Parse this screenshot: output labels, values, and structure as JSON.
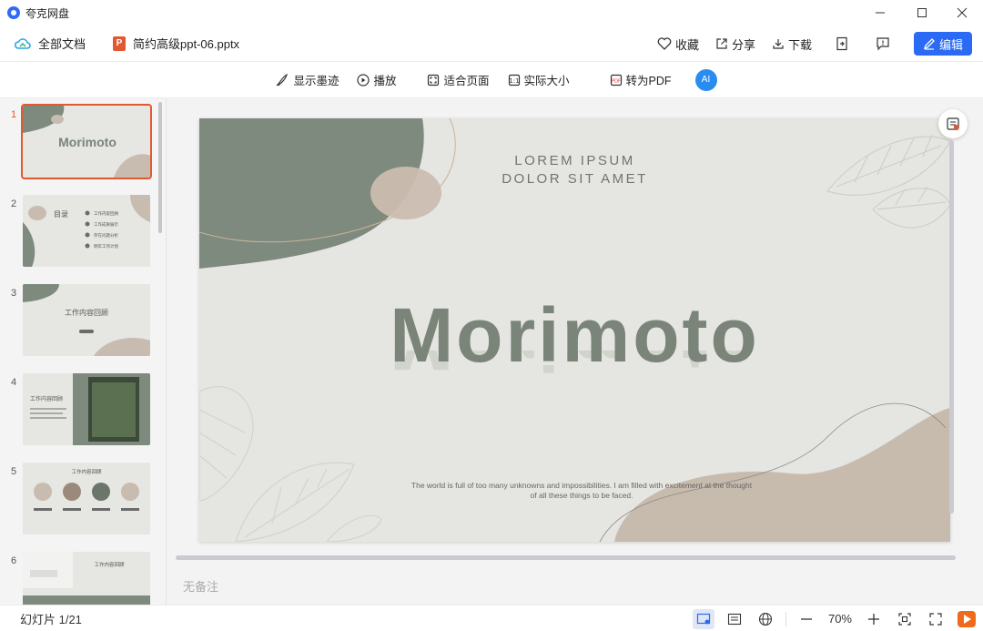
{
  "app": {
    "name": "夸克网盘"
  },
  "window": {
    "minimize": "—",
    "maximize": "☐",
    "close": "✕"
  },
  "header": {
    "all_docs": "全部文档",
    "file_icon": "P",
    "filename": "简约高级ppt-06.pptx",
    "collect": "收藏",
    "share": "分享",
    "download": "下载",
    "edit": "编辑"
  },
  "toolbar": {
    "show_ink": "显示墨迹",
    "play": "播放",
    "fit_page": "适合页面",
    "actual_size": "实际大小",
    "to_pdf": "转为PDF",
    "ai": "AI"
  },
  "thumbnails": [
    {
      "num": "1",
      "title": "Morimoto",
      "active": true
    },
    {
      "num": "2",
      "title": "目录",
      "items": [
        "工作内容回顾",
        "工作成果展示",
        "存在问题分析",
        "明年工作计划"
      ]
    },
    {
      "num": "3",
      "title": "工作内容回顾"
    },
    {
      "num": "4",
      "title": "工作内容回顾"
    },
    {
      "num": "5",
      "title": "工作内容回顾"
    },
    {
      "num": "6",
      "title": "工作内容回顾"
    }
  ],
  "slide": {
    "subtitle1": "LOREM IPSUM",
    "subtitle2": "DOLOR SIT AMET",
    "title": "Morimoto",
    "caption": "The world is full of too many unknowns and impossibilities. I am filled with excitement at the thought of all these things to be faced.",
    "colors": {
      "green": "#7d8a7d",
      "beige": "#c8bcb0",
      "bg": "#e5e5e1"
    }
  },
  "notes_placeholder": "无备注",
  "status": {
    "slide_counter": "幻灯片 1/21",
    "zoom": "70%"
  }
}
